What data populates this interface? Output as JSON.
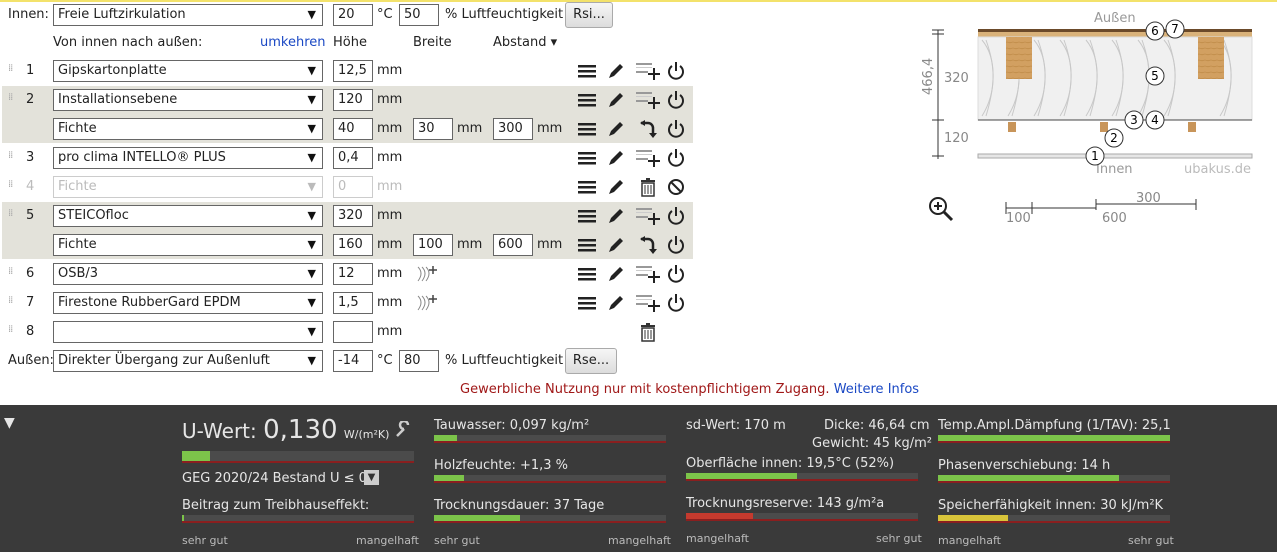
{
  "inside": {
    "label": "Innen:",
    "condition": "Freie Luftzirkulation",
    "temp": "20",
    "temp_unit": "°C",
    "humidity": "50",
    "humidity_unit": "% Luftfeuchtigkeit",
    "rsi_button": "Rsi..."
  },
  "header": {
    "direction": "Von innen nach außen:",
    "reverse_link": "umkehren",
    "height": "Höhe",
    "width": "Breite",
    "spacing": "Abstand ▾"
  },
  "layers": [
    {
      "num": "1",
      "material": "Gipskartonplatte",
      "height": "12,5"
    },
    {
      "num": "2",
      "material": "Installationsebene",
      "height": "120",
      "sub": {
        "material": "Fichte",
        "height": "40",
        "width": "30",
        "spacing": "300"
      }
    },
    {
      "num": "3",
      "material": "pro clima INTELLO® PLUS",
      "height": "0,4"
    },
    {
      "num": "4",
      "material": "Fichte",
      "height": "0"
    },
    {
      "num": "5",
      "material": "STEICOfloc",
      "height": "320",
      "sub": {
        "material": "Fichte",
        "height": "160",
        "width": "100",
        "spacing": "600"
      }
    },
    {
      "num": "6",
      "material": "OSB/3",
      "height": "12"
    },
    {
      "num": "7",
      "material": "Firestone RubberGard EPDM",
      "height": "1,5"
    },
    {
      "num": "8",
      "material": "",
      "height": ""
    }
  ],
  "units": {
    "mm": "mm"
  },
  "outside": {
    "label": "Außen:",
    "condition": "Direkter Übergang zur Außenluft",
    "temp": "-14",
    "temp_unit": "°C",
    "humidity": "80",
    "humidity_unit": "% Luftfeuchtigkeit",
    "rse_button": "Rse..."
  },
  "notice": {
    "text": "Gewerbliche Nutzung nur mit kostenpflichtigem Zugang.",
    "link": "Weitere Infos"
  },
  "diagram": {
    "outside_label": "Außen",
    "inside_label": "Innen",
    "watermark": "ubakus.de",
    "dim_total": "466,4",
    "dim_320": "320",
    "dim_120": "120",
    "dim_300": "300",
    "dim_100": "100",
    "dim_600": "600",
    "markers": [
      "1",
      "2",
      "3",
      "4",
      "5",
      "6",
      "7"
    ]
  },
  "results": {
    "u_label": "U-Wert:",
    "u_value": "0,130",
    "u_unit": "W/(m²K)",
    "u_fill": 0.12,
    "geg": "GEG 2020/24 Bestand U ≤ 0,2",
    "greenhouse": "Beitrag zum Treibhauseffekt:",
    "greenhouse_fill": 0.01,
    "scale_good": "sehr gut",
    "scale_bad": "mangelhaft",
    "condensate": "Tauwasser: 0,097 kg/m²",
    "condensate_fill": 0.1,
    "wood_moisture": "Holzfeuchte: +1,3 %",
    "wood_moisture_fill": 0.13,
    "drying_time": "Trocknungsdauer: 37 Tage",
    "drying_time_fill": 0.37,
    "sd_value": "sd-Wert: 170 m",
    "thickness": "Dicke: 46,64 cm",
    "weight": "Gewicht: 45 kg/m²",
    "surface_temp": "Oberfläche innen: 19,5°C (52%)",
    "surface_temp_fill": 0.48,
    "drying_reserve": "Trocknungsreserve: 143 g/m²a",
    "drying_reserve_fill": 0.29,
    "temp_damping": "Temp.Ampl.Dämpfung (1/TAV): 25,1",
    "temp_damping_fill": 1.0,
    "phase_shift": "Phasenverschiebung: 14 h",
    "phase_shift_fill": 0.78,
    "storage": "Speicherfähigkeit innen: 30 kJ/m²K",
    "storage_fill": 0.3,
    "scale_bad2": "mangelhaft",
    "scale_good2": "sehr gut"
  }
}
